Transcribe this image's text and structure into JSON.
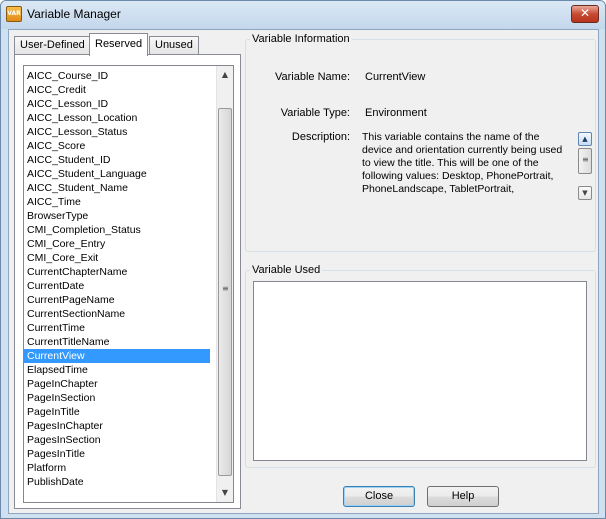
{
  "window": {
    "title": "Variable Manager",
    "icon_text": "VAR",
    "close_glyph": "✕"
  },
  "tabs": [
    {
      "label": "User-Defined",
      "active": false
    },
    {
      "label": "Reserved",
      "active": true
    },
    {
      "label": "Unused",
      "active": false
    }
  ],
  "variable_list": {
    "selected_index": 20,
    "items": [
      "AICC_Course_ID",
      "AICC_Credit",
      "AICC_Lesson_ID",
      "AICC_Lesson_Location",
      "AICC_Lesson_Status",
      "AICC_Score",
      "AICC_Student_ID",
      "AICC_Student_Language",
      "AICC_Student_Name",
      "AICC_Time",
      "BrowserType",
      "CMI_Completion_Status",
      "CMI_Core_Entry",
      "CMI_Core_Exit",
      "CurrentChapterName",
      "CurrentDate",
      "CurrentPageName",
      "CurrentSectionName",
      "CurrentTime",
      "CurrentTitleName",
      "CurrentView",
      "ElapsedTime",
      "PageInChapter",
      "PageInSection",
      "PageInTitle",
      "PagesInChapter",
      "PagesInSection",
      "PagesInTitle",
      "Platform",
      "PublishDate"
    ]
  },
  "variable_info": {
    "group_label": "Variable Information",
    "name_label": "Variable Name:",
    "name_value": "CurrentView",
    "type_label": "Variable Type:",
    "type_value": "Environment",
    "description_label": "Description:",
    "description_lines": [
      "This variable contains the name of the",
      "device and orientation currently being used",
      "to view the title. This will be one of the",
      "following values: Desktop, PhonePortrait,",
      "PhoneLandscape, TabletPortrait,"
    ]
  },
  "variable_used": {
    "group_label": "Variable Used"
  },
  "buttons": {
    "close": "Close",
    "help": "Help"
  },
  "glyphs": {
    "up": "▲",
    "down": "▼",
    "grip": "≡"
  }
}
